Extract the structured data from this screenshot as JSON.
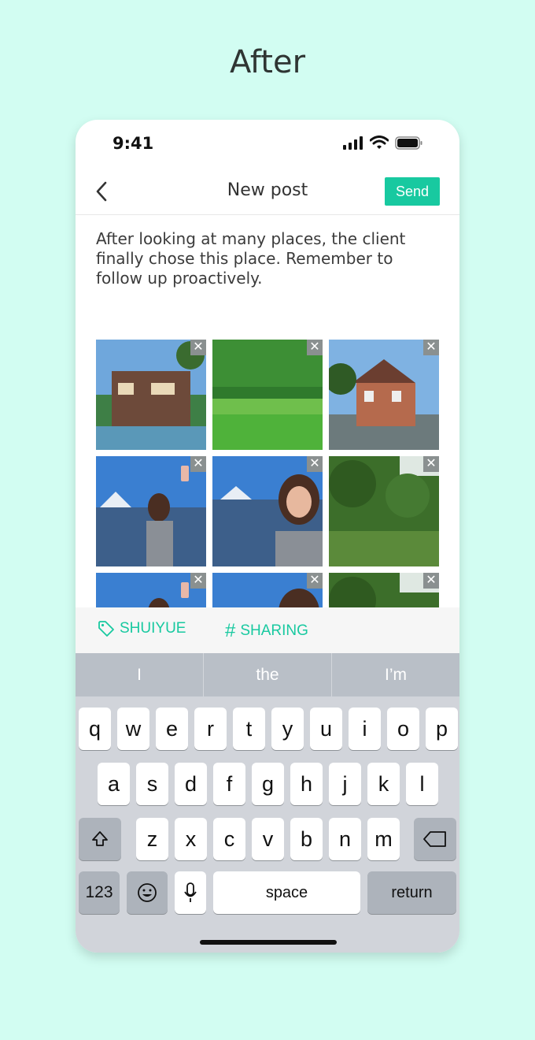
{
  "heading": "After",
  "status": {
    "time": "9:41"
  },
  "nav": {
    "title": "New post",
    "send_label": "Send"
  },
  "post": {
    "text": "After looking at many places, the client finally chose this place. Remember to follow up proactively."
  },
  "photos": [
    {
      "subject": "modern villa"
    },
    {
      "subject": "green field"
    },
    {
      "subject": "brick mansion"
    },
    {
      "subject": "woman selfie by lake"
    },
    {
      "subject": "woman by lake"
    },
    {
      "subject": "forest garden"
    },
    {
      "subject": "woman selfie by lake"
    },
    {
      "subject": "woman by lake"
    },
    {
      "subject": "forest garden"
    }
  ],
  "tags": {
    "location": "SHUIYUE",
    "topic": "SHARING"
  },
  "keyboard": {
    "suggestions": [
      "I",
      "the",
      "I’m"
    ],
    "row1": [
      "q",
      "w",
      "e",
      "r",
      "t",
      "y",
      "u",
      "i",
      "o",
      "p"
    ],
    "row2": [
      "a",
      "s",
      "d",
      "f",
      "g",
      "h",
      "j",
      "k",
      "l"
    ],
    "row3": [
      "z",
      "x",
      "c",
      "v",
      "b",
      "n",
      "m"
    ],
    "numbers_label": "123",
    "space_label": "space",
    "return_label": "return"
  },
  "colors": {
    "accent": "#18c9a0",
    "background": "#d2fdf2"
  }
}
